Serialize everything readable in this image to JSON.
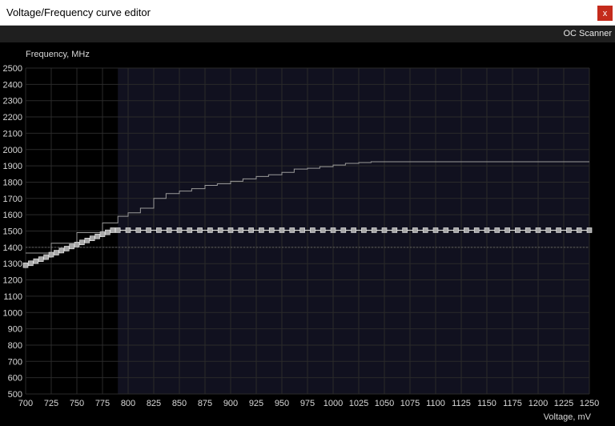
{
  "window": {
    "title": "Voltage/Frequency curve editor",
    "close_label": "x",
    "close_color": "#c42b1c"
  },
  "toolbar": {
    "oc_scanner_label": "OC Scanner"
  },
  "chart_data": {
    "type": "line",
    "ylabel": "Frequency, MHz",
    "xlabel": "Voltage, mV",
    "xlim": [
      700,
      1250
    ],
    "ylim": [
      500,
      2500
    ],
    "x_ticks": [
      700,
      725,
      750,
      775,
      800,
      825,
      850,
      875,
      900,
      925,
      950,
      975,
      1000,
      1025,
      1050,
      1075,
      1100,
      1125,
      1150,
      1175,
      1200,
      1225,
      1250
    ],
    "y_ticks": [
      500,
      600,
      700,
      800,
      900,
      1000,
      1100,
      1200,
      1300,
      1400,
      1500,
      1600,
      1700,
      1800,
      1900,
      2000,
      2100,
      2200,
      2300,
      2400,
      2500
    ],
    "grid": true,
    "highlighted_range_start": 790,
    "reference_line": 1400,
    "colors": {
      "background": "#000000",
      "highlight_region": "#11111f",
      "grid": "#2a2a2a",
      "default_curve": "#9a9a9a",
      "edited_curve": "#e8e8e8",
      "reference_line": "#606060"
    },
    "series": [
      {
        "id": "default_curve",
        "x": [
          700,
          725,
          750,
          775,
          790,
          800,
          812,
          825,
          837,
          850,
          862,
          875,
          887,
          900,
          912,
          925,
          937,
          950,
          962,
          975,
          987,
          1000,
          1012,
          1025,
          1037,
          1050,
          1100,
          1150,
          1200,
          1250
        ],
        "y": [
          1365,
          1425,
          1490,
          1550,
          1590,
          1612,
          1640,
          1700,
          1730,
          1745,
          1760,
          1780,
          1790,
          1805,
          1820,
          1835,
          1845,
          1860,
          1880,
          1885,
          1895,
          1905,
          1915,
          1920,
          1925,
          1925,
          1925,
          1925,
          1925,
          1925
        ]
      },
      {
        "id": "edited_curve",
        "x": [
          700,
          705,
          710,
          715,
          720,
          725,
          730,
          735,
          740,
          745,
          750,
          755,
          760,
          765,
          770,
          775,
          780,
          785,
          790,
          800,
          810,
          820,
          830,
          840,
          850,
          860,
          870,
          880,
          890,
          900,
          910,
          920,
          930,
          940,
          950,
          960,
          970,
          980,
          990,
          1000,
          1010,
          1020,
          1030,
          1040,
          1050,
          1060,
          1070,
          1080,
          1090,
          1100,
          1110,
          1120,
          1130,
          1140,
          1150,
          1160,
          1170,
          1180,
          1190,
          1200,
          1210,
          1220,
          1230,
          1240,
          1250
        ],
        "y": [
          1290,
          1302,
          1315,
          1327,
          1340,
          1355,
          1367,
          1380,
          1392,
          1405,
          1417,
          1430,
          1442,
          1455,
          1467,
          1480,
          1492,
          1505,
          1505,
          1505,
          1505,
          1505,
          1505,
          1505,
          1505,
          1505,
          1505,
          1505,
          1505,
          1505,
          1505,
          1505,
          1505,
          1505,
          1505,
          1505,
          1505,
          1505,
          1505,
          1505,
          1505,
          1505,
          1505,
          1505,
          1505,
          1505,
          1505,
          1505,
          1505,
          1505,
          1505,
          1505,
          1505,
          1505,
          1505,
          1505,
          1505,
          1505,
          1505,
          1505,
          1505,
          1505,
          1505,
          1505,
          1505
        ]
      }
    ]
  }
}
